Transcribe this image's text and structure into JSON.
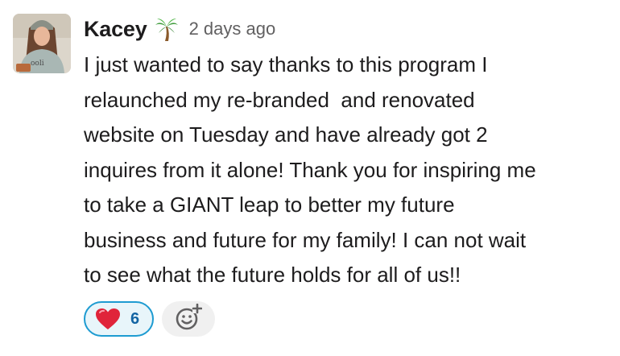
{
  "message": {
    "author": "Kacey",
    "status_emoji": "palm-tree",
    "timestamp": "2 days ago",
    "lines": [
      "I just wanted to say thanks to this program I",
      "relaunched my re-branded  and renovated",
      "website on Tuesday and have already got 2",
      "inquires from it alone! Thank you for inspiring me",
      "to take a GIANT leap to better my future",
      "business and future for my family! I can not wait",
      "to see what the future holds for all of us!!"
    ]
  },
  "reactions": [
    {
      "emoji": "red-heart",
      "count": "6",
      "selected": true
    }
  ],
  "add_reaction": {
    "icon": "add-reaction-icon"
  },
  "colors": {
    "text": "#1d1c1d",
    "muted": "#616061",
    "reaction_border": "#1d9bd1",
    "reaction_bg": "#e8f5fa",
    "reaction_count": "#1264a3",
    "heart": "#e0243a"
  }
}
